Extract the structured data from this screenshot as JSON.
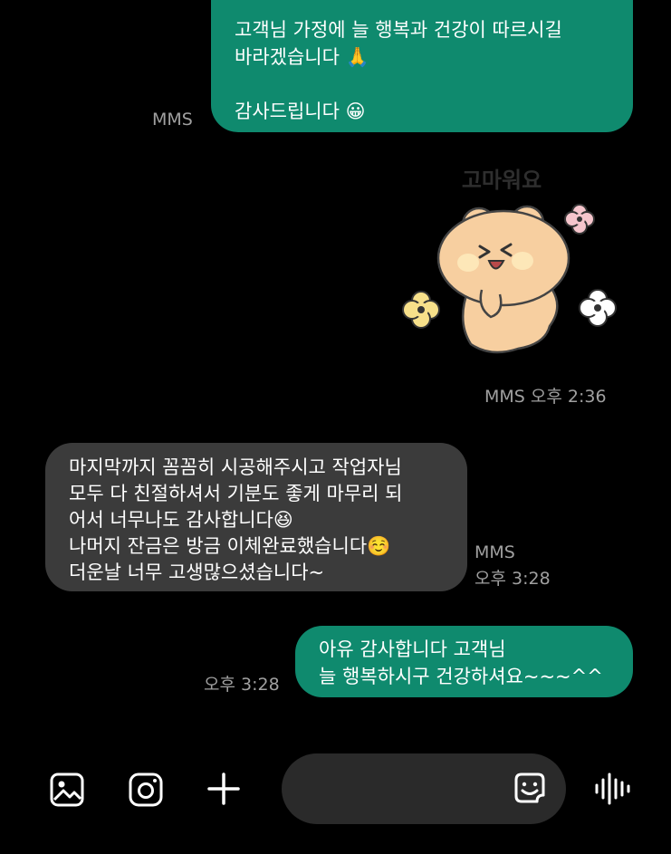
{
  "messages": [
    {
      "direction": "sent",
      "type": "text",
      "text": "고객님 가정에 늘 행복과 건강이 따르시길\n바라겠습니다 🙏\n\n감사드립니다 😀",
      "meta": "MMS"
    },
    {
      "direction": "sent",
      "type": "sticker",
      "sticker_text": "고마워요",
      "meta": "MMS 오후 2:36"
    },
    {
      "direction": "received",
      "type": "text",
      "text": "마지막까지 꼼꼼히 시공해주시고 작업자님\n모두 다 친절하셔서 기분도 좋게 마무리 되\n어서 너무나도 감사합니다😆\n나머지 잔금은 방금 이체완료했습니다☺️\n더운날 너무 고생많으셨습니다~",
      "meta": "MMS\n오후 3:28"
    },
    {
      "direction": "sent",
      "type": "text",
      "text": "아유 감사합니다 고객님\n늘 행복하시구 건강하셔요~~~^^",
      "meta": "오후 3:28"
    }
  ],
  "toolbar": {
    "input_placeholder": "",
    "icons": [
      "gallery-icon",
      "camera-icon",
      "plus-icon",
      "emoji-sticker-icon",
      "voice-record-icon"
    ]
  },
  "colors": {
    "sent_bubble": "#0f8a6e",
    "received_bubble": "#3b3b3b",
    "background": "#000000",
    "meta_text": "#a0a0a0"
  }
}
